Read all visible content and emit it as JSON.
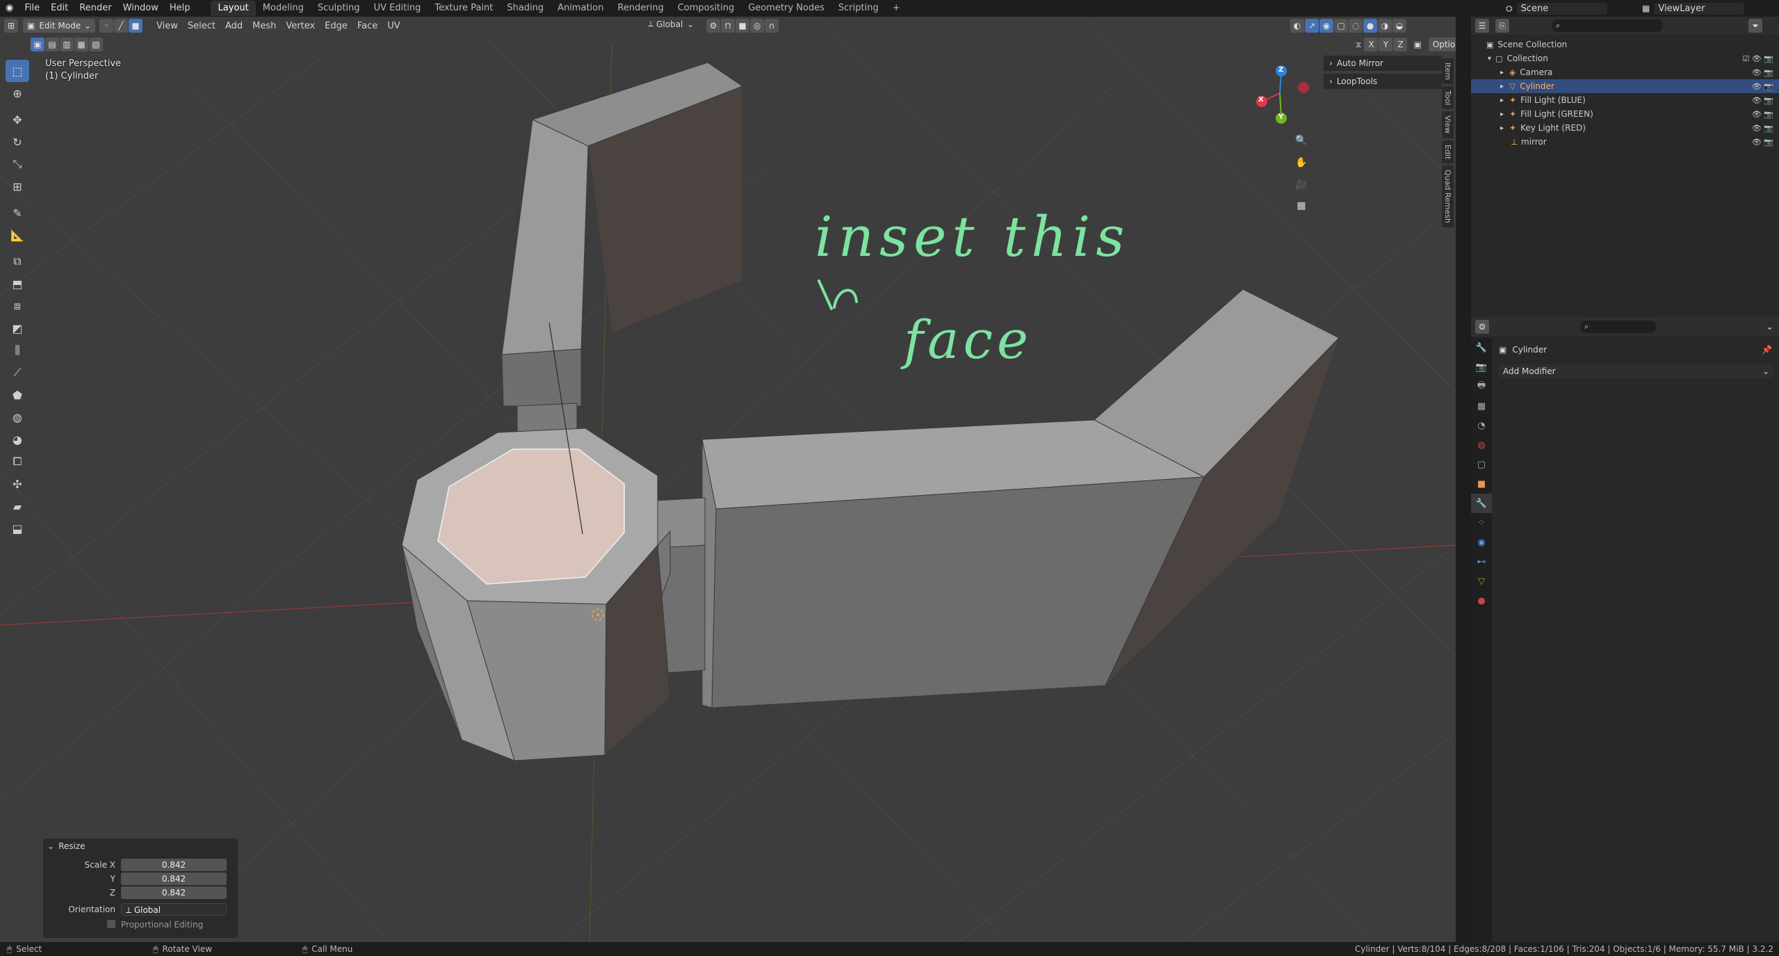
{
  "menubar": {
    "menus": [
      "File",
      "Edit",
      "Render",
      "Window",
      "Help"
    ],
    "workspaces": [
      "Layout",
      "Modeling",
      "Sculpting",
      "UV Editing",
      "Texture Paint",
      "Shading",
      "Animation",
      "Rendering",
      "Compositing",
      "Geometry Nodes",
      "Scripting"
    ],
    "add_tab": "+",
    "scene_name": "Scene",
    "view_layer": "ViewLayer"
  },
  "viewport_header": {
    "mode": "Edit Mode",
    "menus": [
      "View",
      "Select",
      "Add",
      "Mesh",
      "Vertex",
      "Edge",
      "Face",
      "UV"
    ],
    "orientation": "Global",
    "axes": [
      "X",
      "Y",
      "Z"
    ],
    "options_label": "Options"
  },
  "viewport": {
    "perspective": "User Perspective",
    "object": "(1) Cylinder",
    "annotation_line1": "inset this",
    "annotation_line2": "face",
    "popovers": [
      "Auto Mirror",
      "LoopTools"
    ],
    "npanel_tabs": [
      "Item",
      "Tool",
      "View",
      "Edit",
      "Quad Remesh"
    ],
    "gizmo_axes": {
      "x": "X",
      "y": "Y",
      "z": "Z"
    },
    "colors": {
      "x": "#e0384a",
      "y": "#6fba1f",
      "z": "#2f83d6",
      "annotation": "#7de3a0",
      "selected_face": "#d9c4bc"
    }
  },
  "operator_panel": {
    "title": "Resize",
    "rows": [
      {
        "label": "Scale X",
        "value": "0.842"
      },
      {
        "label": "Y",
        "value": "0.842"
      },
      {
        "label": "Z",
        "value": "0.842"
      }
    ],
    "orientation_label": "Orientation",
    "orientation_value": "Global",
    "proportional_label": "Proportional Editing"
  },
  "statusbar": {
    "select": "Select",
    "rotate": "Rotate View",
    "menu": "Call Menu",
    "stats": "Cylinder | Verts:8/104 | Edges:8/208 | Faces:1/106 | Tris:204 | Objects:1/6 | Memory: 55.7 MiB | 3.2.2"
  },
  "outliner": {
    "root": "Scene Collection",
    "collection": "Collection",
    "items": [
      {
        "name": "Camera",
        "icon": "camera-icon",
        "selected": false
      },
      {
        "name": "Cylinder",
        "icon": "mesh-icon",
        "selected": true
      },
      {
        "name": "Fill Light (BLUE)",
        "icon": "light-icon",
        "selected": false
      },
      {
        "name": "Fill Light (GREEN)",
        "icon": "light-icon",
        "selected": false
      },
      {
        "name": "Key Light (RED)",
        "icon": "light-icon",
        "selected": false
      },
      {
        "name": "mirror",
        "icon": "empty-icon",
        "selected": false
      }
    ]
  },
  "properties": {
    "object_name": "Cylinder",
    "add_modifier": "Add Modifier"
  }
}
